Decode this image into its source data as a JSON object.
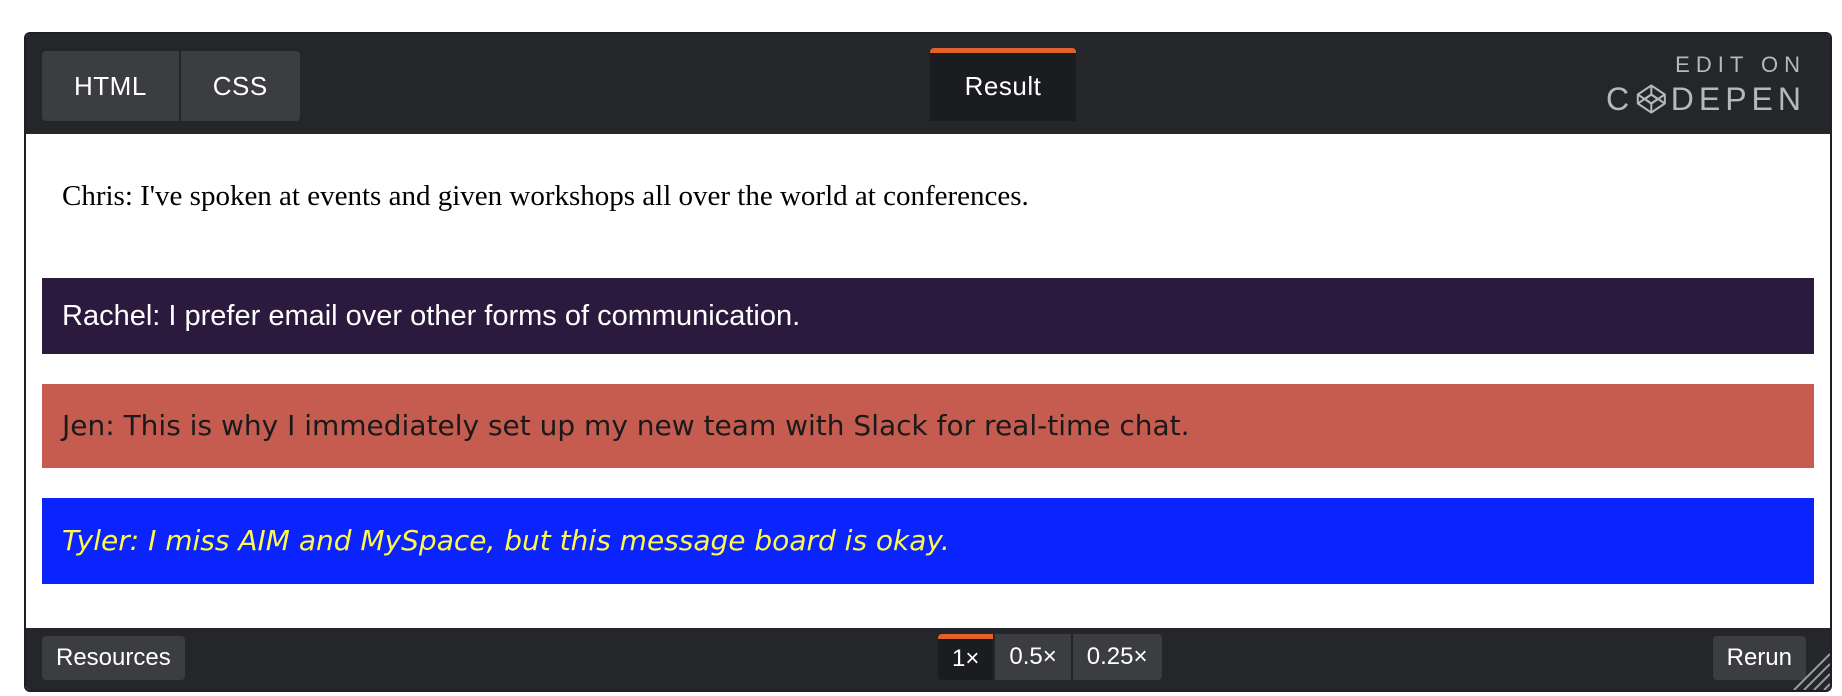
{
  "topbar": {
    "tabs": [
      {
        "label": "HTML"
      },
      {
        "label": "CSS"
      }
    ],
    "result_tab": "Result",
    "edit_on": "EDIT ON",
    "codepen_brand": {
      "before": "C",
      "after": "DEPEN"
    }
  },
  "messages": [
    {
      "text": "Chris: I've spoken at events and given workshops all over the world at conferences.",
      "background": "#ffffff",
      "color": "#000000"
    },
    {
      "text": "Rachel: I prefer email over other forms of communication.",
      "background": "#2b1a3d",
      "color": "#ffffff"
    },
    {
      "text": "Jen: This is why I immediately set up my new team with Slack for real-time chat.",
      "background": "#c65c50",
      "color": "#1a1a1a"
    },
    {
      "text": "Tyler: I miss AIM and MySpace, but this message board is okay.",
      "background": "#0b23ff",
      "color": "#fff94c"
    }
  ],
  "bottombar": {
    "resources_label": "Resources",
    "zoom_options": [
      "1×",
      "0.5×",
      "0.25×"
    ],
    "active_zoom": "1×",
    "rerun_label": "Rerun"
  },
  "colors": {
    "accent": "#e2612c",
    "bar_background": "#252629",
    "tab_background": "#3c3d40"
  },
  "icons": [
    "codepen-logo-icon",
    "resize-handle-icon"
  ]
}
